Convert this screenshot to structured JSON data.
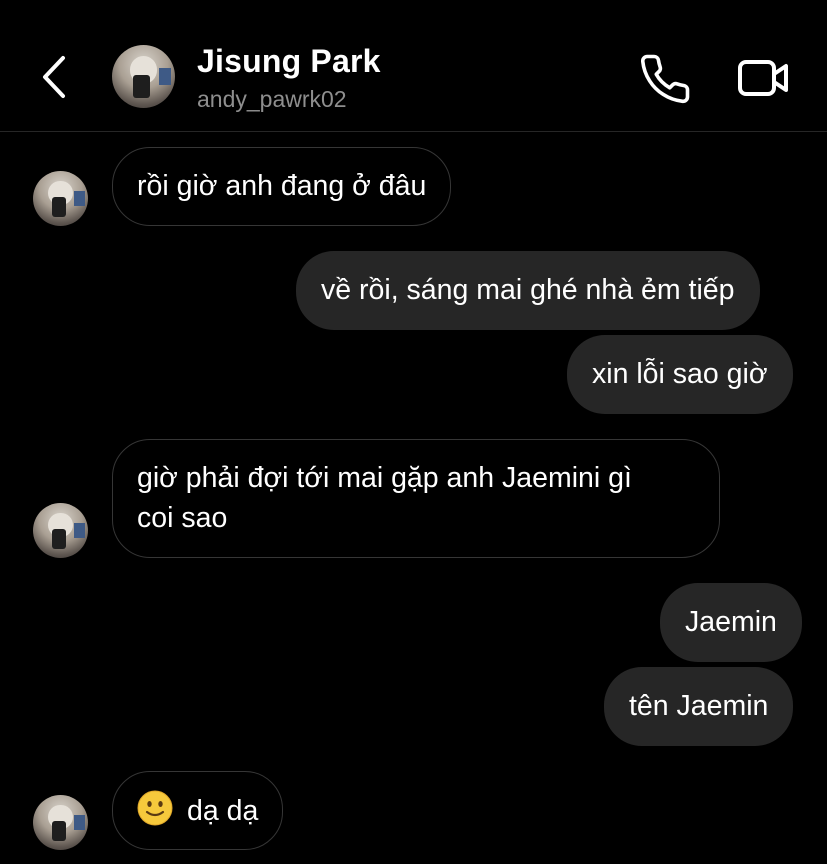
{
  "header": {
    "contact_name": "Jisung Park",
    "contact_username": "andy_pawrk02"
  },
  "messages": [
    {
      "direction": "incoming",
      "text": "rồi giờ anh đang ở đâu"
    },
    {
      "direction": "outgoing",
      "text": "về rồi, sáng mai ghé nhà ẻm tiếp"
    },
    {
      "direction": "outgoing",
      "text": "xin lỗi sao giờ"
    },
    {
      "direction": "incoming",
      "text_line1": "giờ phải đợi tới mai gặp anh Jaemini gì",
      "text_line2": "coi sao"
    },
    {
      "direction": "outgoing",
      "text": "Jaemin"
    },
    {
      "direction": "outgoing",
      "text": "tên Jaemin"
    },
    {
      "direction": "incoming",
      "emoji": "slightly-smiling-face-emoji",
      "text": "dạ dạ"
    }
  ],
  "icons": {
    "back": "chevron-left-icon",
    "call": "phone-icon",
    "video": "video-camera-icon"
  },
  "colors": {
    "background": "#000000",
    "outgoing_bubble": "#262626",
    "incoming_border": "#363636",
    "username": "#8e8e8e"
  }
}
